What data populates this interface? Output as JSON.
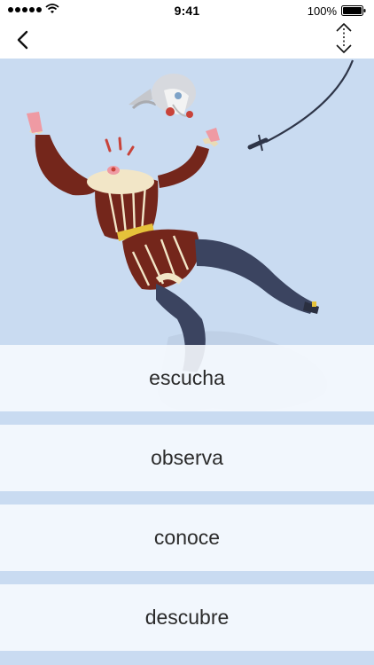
{
  "status_bar": {
    "time": "9:41",
    "battery_percent": "100%",
    "signal_bars": 5
  },
  "nav": {
    "back_icon": "chevron-left-icon",
    "resize_icon": "expand-vertical-icon"
  },
  "hero": {
    "illustration": "jester-figure-losing-head",
    "background_color": "#c9dbf1"
  },
  "words": [
    {
      "label": "escucha"
    },
    {
      "label": "observa"
    },
    {
      "label": "conoce"
    },
    {
      "label": "descubre"
    }
  ]
}
